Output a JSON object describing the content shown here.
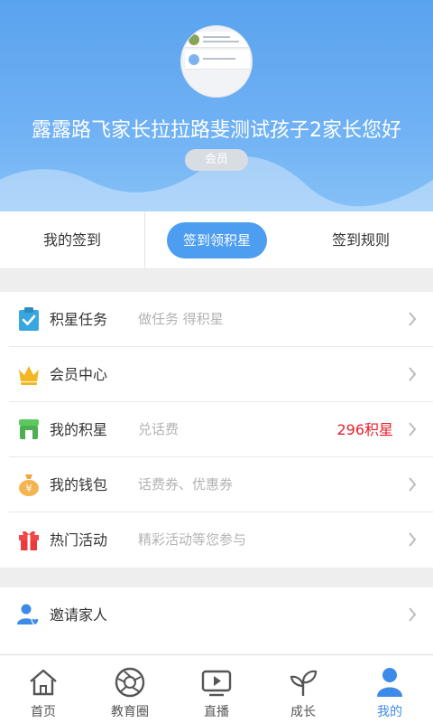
{
  "profile": {
    "username": "露露路飞家长拉拉路斐测试孩子2家长您好",
    "badge": "会员"
  },
  "signin": {
    "my_sign": "我的签到",
    "sign_button": "签到领积星",
    "rules": "签到规则"
  },
  "menu1": [
    {
      "icon": "clipboard-check-icon",
      "label": "积星任务",
      "sub": "做任务 得积星",
      "value": ""
    },
    {
      "icon": "crown-icon",
      "label": "会员中心",
      "sub": "",
      "value": ""
    },
    {
      "icon": "shop-icon",
      "label": "我的积星",
      "sub": "兑话费",
      "value": "296积星"
    },
    {
      "icon": "money-bag-icon",
      "label": "我的钱包",
      "sub": "话费券、优惠券",
      "value": ""
    },
    {
      "icon": "gift-icon",
      "label": "热门活动",
      "sub": "精彩活动等您参与",
      "value": ""
    }
  ],
  "menu2": [
    {
      "icon": "invite-family-icon",
      "label": "邀请家人",
      "sub": "",
      "value": ""
    }
  ],
  "tabs": [
    {
      "icon": "home-icon",
      "label": "首页",
      "active": false
    },
    {
      "icon": "aperture-icon",
      "label": "教育圈",
      "active": false
    },
    {
      "icon": "play-screen-icon",
      "label": "直播",
      "active": false
    },
    {
      "icon": "sprout-icon",
      "label": "成长",
      "active": false
    },
    {
      "icon": "person-icon",
      "label": "我的",
      "active": true
    }
  ],
  "colors": {
    "header_blue": "#5aa3ee",
    "accent_blue": "#4d9df0",
    "value_red": "#e8202a",
    "active_tab": "#3d8be8"
  }
}
